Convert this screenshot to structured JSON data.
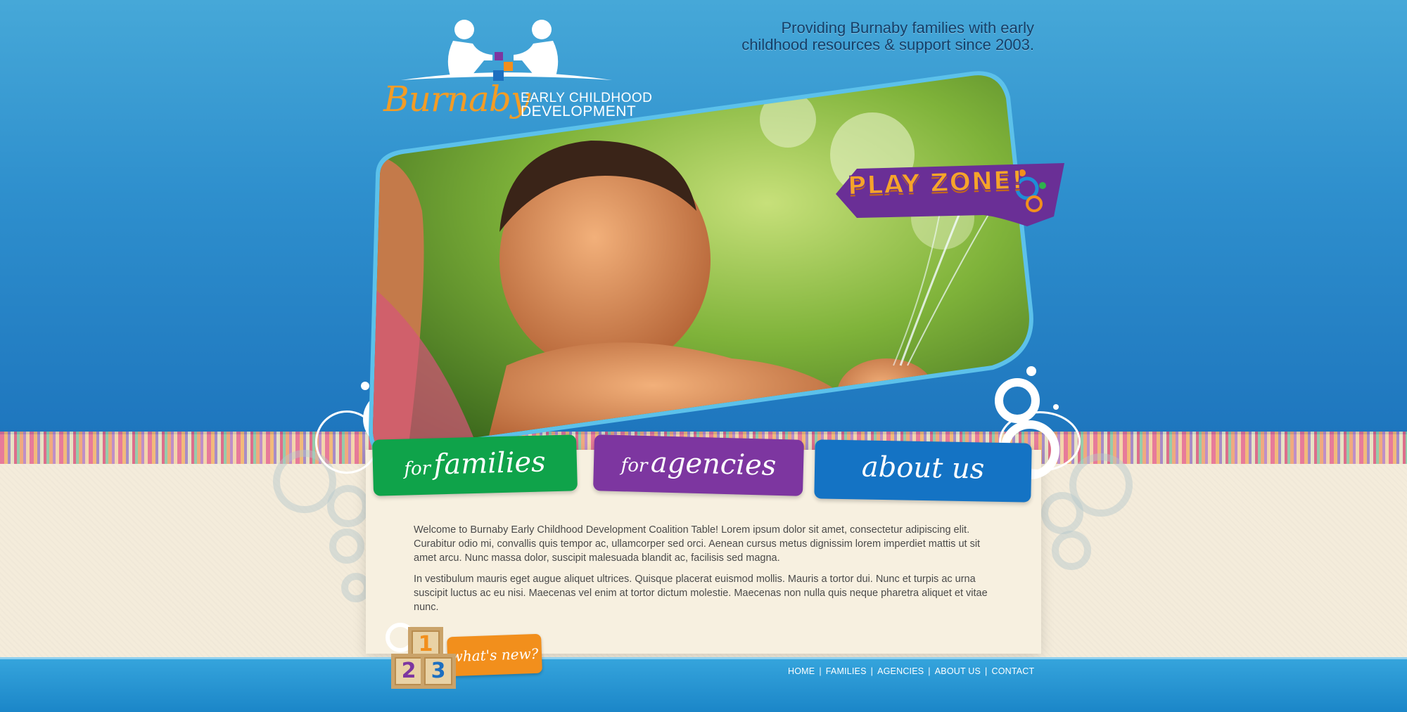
{
  "brand": {
    "word": "Burnaby",
    "sub_line1": "EARLY CHILDHOOD",
    "sub_line2": "DEVELOPMENT"
  },
  "tagline": {
    "line1": "Providing Burnaby families with early",
    "line2": "childhood resources & support since 2003."
  },
  "playzone": {
    "label": "PLAY ZONE!"
  },
  "tabs": [
    {
      "small": "for",
      "big": "families"
    },
    {
      "small": "for",
      "big": "agencies"
    },
    {
      "small": "",
      "big": "about us"
    }
  ],
  "content": {
    "p1": "Welcome to Burnaby Early Childhood Development Coalition Table! Lorem ipsum dolor sit amet, consectetur adipiscing elit. Curabitur odio mi, convallis quis tempor ac, ullamcorper sed orci. Aenean cursus metus dignissim lorem imperdiet mattis ut sit amet arcu. Nunc massa dolor, suscipit malesuada blandit ac, facilisis sed magna.",
    "p2": "In vestibulum mauris eget augue aliquet ultrices. Quisque placerat euismod mollis. Mauris a tortor dui. Nunc et turpis ac urna suscipit luctus ac eu nisi. Maecenas vel enim at tortor dictum molestie. Maecenas non nulla quis neque pharetra aliquet et vitae nunc."
  },
  "whatsnew": {
    "label": "what's new?",
    "blocks": [
      "1",
      "2",
      "3"
    ]
  },
  "footer_nav": {
    "home": "HOME",
    "families": "FAMILIES",
    "agencies": "AGENCIES",
    "about": "ABOUT US",
    "contact": "CONTACT",
    "separator": "|"
  },
  "colors": {
    "sky": "#2e8fcd",
    "orange": "#f39c25",
    "green_tab": "#0fa34a",
    "purple_tab": "#7d36a0",
    "blue_tab": "#1473c4"
  }
}
